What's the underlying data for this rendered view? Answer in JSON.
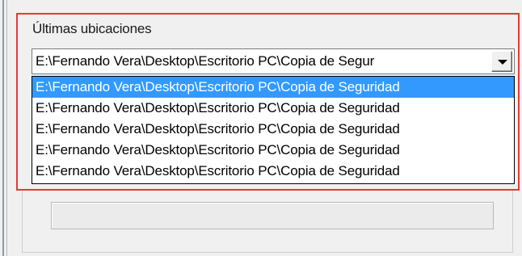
{
  "recent_locations": {
    "label": "Últimas ubicaciones",
    "combo_value": "E:\\Fernando Vera\\Desktop\\Escritorio PC\\Copia de Segur",
    "dropdown_items": [
      "E:\\Fernando Vera\\Desktop\\Escritorio PC\\Copia de Seguridad",
      "E:\\Fernando Vera\\Desktop\\Escritorio PC\\Copia de Seguridad",
      "E:\\Fernando Vera\\Desktop\\Escritorio PC\\Copia de Seguridad",
      "E:\\Fernando Vera\\Desktop\\Escritorio PC\\Copia de Seguridad",
      "E:\\Fernando Vera\\Desktop\\Escritorio PC\\Copia de Seguridad"
    ],
    "selected_index": 0
  },
  "icons": {
    "dropdown_button": "chevron-down-icon"
  },
  "colors": {
    "highlight_border": "#e53935",
    "selection_background": "#3399ff",
    "selection_text": "#ffffff"
  }
}
